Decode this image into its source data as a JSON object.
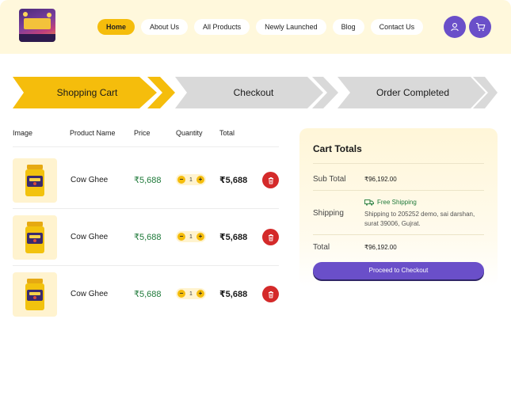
{
  "nav": {
    "items": [
      {
        "label": "Home",
        "active": true
      },
      {
        "label": "About Us"
      },
      {
        "label": "All Products"
      },
      {
        "label": "Newly Launched"
      },
      {
        "label": "Blog"
      },
      {
        "label": "Contact Us"
      }
    ]
  },
  "header": {
    "user_icon": "user-icon",
    "cart_icon": "cart-icon"
  },
  "steps": [
    {
      "label": "Shopping Cart",
      "active": true
    },
    {
      "label": "Checkout"
    },
    {
      "label": "Order Completed"
    }
  ],
  "table": {
    "columns": [
      "Image",
      "Product Name",
      "Price",
      "Quantity",
      "Total"
    ],
    "rows": [
      {
        "name": "Cow Ghee",
        "price": "₹5,688",
        "quantity": "1",
        "total": "₹5,688"
      },
      {
        "name": "Cow Ghee",
        "price": "₹5,688",
        "quantity": "1",
        "total": "₹5,688"
      },
      {
        "name": "Cow Ghee",
        "price": "₹5,688",
        "quantity": "1",
        "total": "₹5,688"
      }
    ],
    "minus_label": "−",
    "plus_label": "+"
  },
  "cart_totals": {
    "title": "Cart Totals",
    "subtotal_label": "Sub Total",
    "subtotal_value": "₹96,192.00",
    "shipping_label": "Shipping",
    "shipping_method": "Free Shipping",
    "shipping_address": "Shipping to 205252 demo, sai darshan, surat 39006, Gujrat.",
    "total_label": "Total",
    "total_value": "₹96,192.00",
    "checkout_label": "Proceed to Checkout"
  },
  "colors": {
    "accent_yellow": "#f5bd0c",
    "accent_purple": "#6a4fc9",
    "delete_red": "#d42a2a",
    "price_green": "#1f7a3a",
    "header_bg": "#fff8dc"
  }
}
